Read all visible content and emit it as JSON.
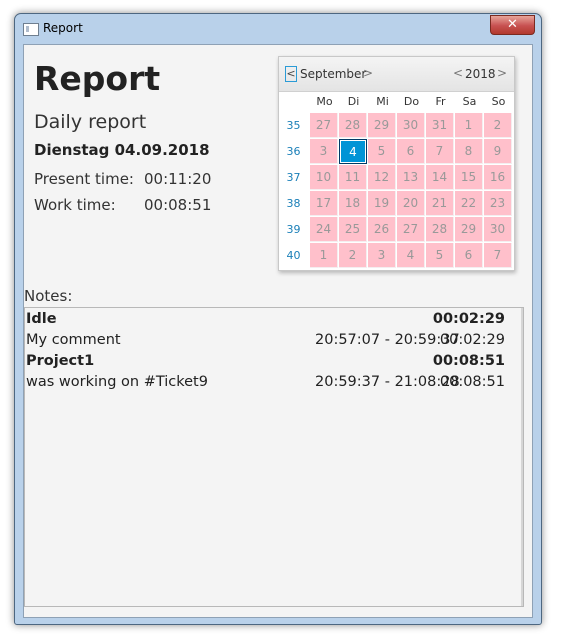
{
  "window": {
    "title": "Report",
    "close_glyph": "✕"
  },
  "header": {
    "title": "Report",
    "subtitle": "Daily report",
    "date": "Dienstag 04.09.2018",
    "present_label": "Present time:",
    "present_value": "00:11:20",
    "work_label": "Work time:",
    "work_value": "00:08:51"
  },
  "calendar": {
    "month": "September",
    "year": "2018",
    "prev_month_glyph": "<",
    "next_month_glyph": ">",
    "prev_year_glyph": "<",
    "next_year_glyph": ">",
    "weekdays": [
      "Mo",
      "Di",
      "Mi",
      "Do",
      "Fr",
      "Sa",
      "So"
    ],
    "weeks": [
      {
        "num": "35",
        "days": [
          "27",
          "28",
          "29",
          "30",
          "31",
          "1",
          "2"
        ]
      },
      {
        "num": "36",
        "days": [
          "3",
          "4",
          "5",
          "6",
          "7",
          "8",
          "9"
        ]
      },
      {
        "num": "37",
        "days": [
          "10",
          "11",
          "12",
          "13",
          "14",
          "15",
          "16"
        ]
      },
      {
        "num": "38",
        "days": [
          "17",
          "18",
          "19",
          "20",
          "21",
          "22",
          "23"
        ]
      },
      {
        "num": "39",
        "days": [
          "24",
          "25",
          "26",
          "27",
          "28",
          "29",
          "30"
        ]
      },
      {
        "num": "40",
        "days": [
          "1",
          "2",
          "3",
          "4",
          "5",
          "6",
          "7"
        ]
      }
    ],
    "selected_day": "4",
    "selected_color": "#0094d6",
    "day_bg_color": "#ffc0cb"
  },
  "notes": {
    "label": "Notes:",
    "rows": [
      {
        "text": "Idle",
        "range": "",
        "duration": "00:02:29",
        "bold": true
      },
      {
        "text": "My comment",
        "range": "20:57:07 - 20:59:37",
        "duration": "00:02:29",
        "bold": false
      },
      {
        "text": "Project1",
        "range": "",
        "duration": "00:08:51",
        "bold": true
      },
      {
        "text": "was working on #Ticket9",
        "range": "20:59:37 - 21:08:28",
        "duration": "00:08:51",
        "bold": false
      }
    ]
  }
}
